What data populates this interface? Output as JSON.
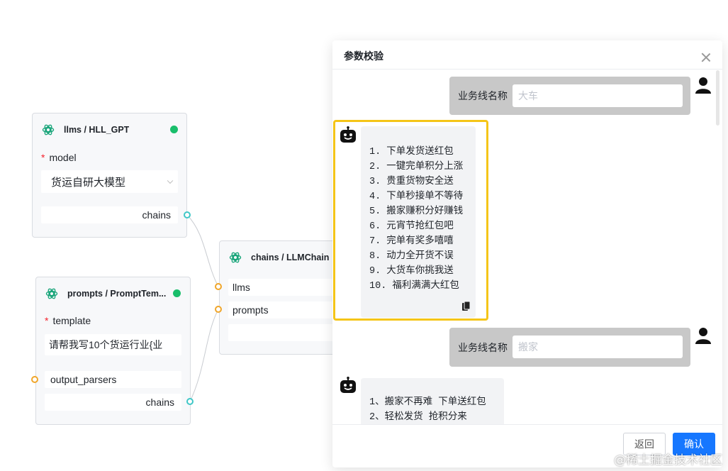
{
  "nodes": {
    "llms": {
      "title": "llms / HLL_GPT",
      "model_label": "model",
      "model_value": "货运自研大模型",
      "output_label": "chains"
    },
    "prompts": {
      "title": "prompts / PromptTem...",
      "template_label": "template",
      "template_value": "请帮我写10个货运行业{业",
      "output_parsers_label": "output_parsers",
      "output_label": "chains"
    },
    "chains": {
      "title": "chains / LLMChain",
      "llms_label": "llms",
      "prompts_label": "prompts"
    },
    "required_mark": "*"
  },
  "modal": {
    "title": "参数校验",
    "messages": [
      {
        "role": "user",
        "label": "业务线名称",
        "placeholder": "大车"
      },
      {
        "role": "bot",
        "items": [
          "1. 下单发货送红包",
          "2. 一键完单积分上涨",
          "3. 贵重货物安全送",
          "4. 下单秒接单不等待",
          "5. 搬家赚积分好赚钱",
          "6. 元宵节抢红包吧",
          "7. 完单有奖多嘻嘻",
          "8. 动力全开货不误",
          "9. 大货车你挑我送",
          "10. 福利满满大红包"
        ]
      },
      {
        "role": "user",
        "label": "业务线名称",
        "placeholder": "搬家"
      },
      {
        "role": "bot",
        "items": [
          "1、搬家不再难 下单送红包",
          "2、轻松发货 抢积分来"
        ]
      }
    ],
    "buttons": {
      "back": "返回",
      "confirm": "确认"
    }
  },
  "watermark": "@稀土掘金技术社区",
  "colors": {
    "status_green": "#19be6b",
    "port_cyan": "#3fc7c7",
    "port_orange": "#f0a62a",
    "highlight_yellow": "#f5c518",
    "primary_blue": "#1677ff"
  }
}
